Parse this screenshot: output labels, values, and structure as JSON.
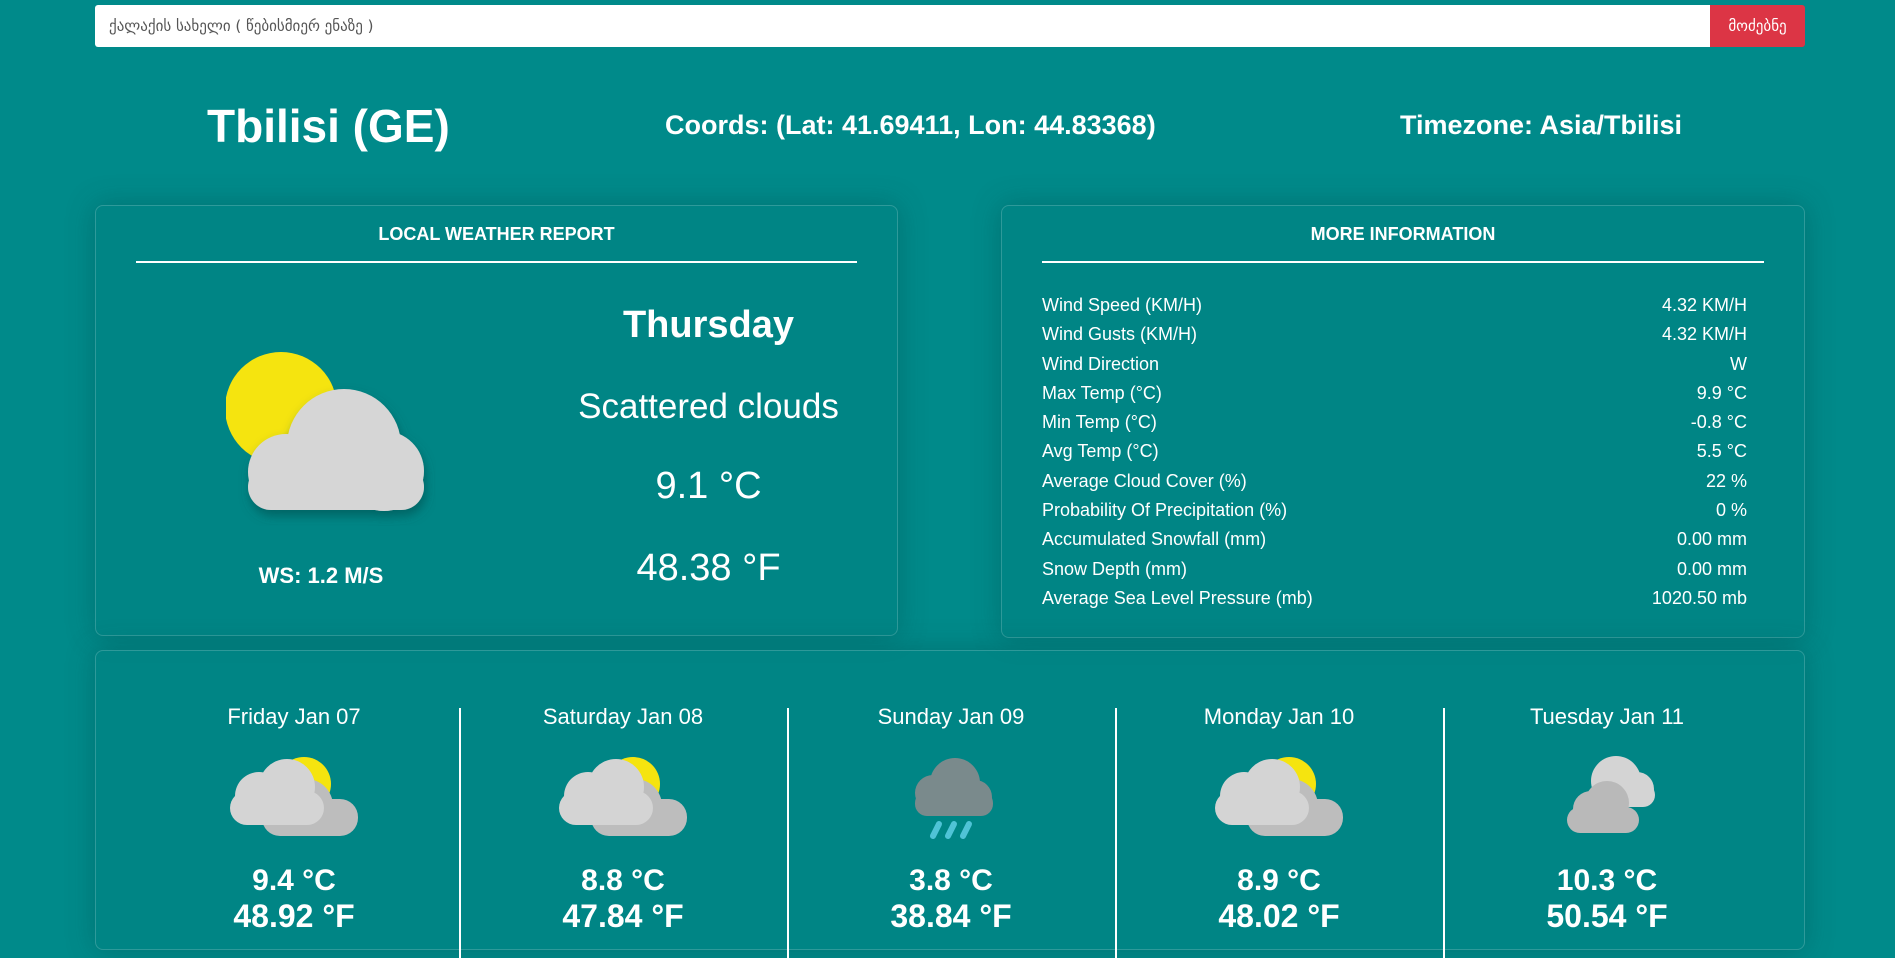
{
  "search": {
    "placeholder": "ქალაქის სახელი ( წებისმიერ ენაზე )",
    "button_label": "მოძებნე"
  },
  "header": {
    "city": "Tbilisi (GE)",
    "coords": "Coords: (Lat: 41.69411, Lon: 44.83368)",
    "timezone": "Timezone: Asia/Tbilisi"
  },
  "local_report": {
    "title": "LOCAL WEATHER REPORT",
    "icon": "partly-cloudy-day-icon",
    "wind_speed": "WS: 1.2 M/S",
    "day": "Thursday",
    "condition": "Scattered clouds",
    "temp_c": "9.1 °C",
    "temp_f": "48.38 °F"
  },
  "more_info": {
    "title": "MORE INFORMATION",
    "rows": [
      {
        "label": "Wind Speed (KM/H)",
        "value": "4.32 KM/H"
      },
      {
        "label": "Wind Gusts (KM/H)",
        "value": "4.32 KM/H"
      },
      {
        "label": "Wind Direction",
        "value": "W"
      },
      {
        "label": "Max Temp (°C)",
        "value": "9.9 °C"
      },
      {
        "label": "Min Temp (°C)",
        "value": "-0.8 °C"
      },
      {
        "label": "Avg Temp (°C)",
        "value": "5.5 °C"
      },
      {
        "label": "Average Cloud Cover (%)",
        "value": "22 %"
      },
      {
        "label": "Probability Of Precipitation (%)",
        "value": "0 %"
      },
      {
        "label": "Accumulated Snowfall (mm)",
        "value": "0.00 mm"
      },
      {
        "label": "Snow Depth (mm)",
        "value": "0.00 mm"
      },
      {
        "label": "Average Sea Level Pressure (mb)",
        "value": "1020.50 mb"
      }
    ]
  },
  "forecast": [
    {
      "date": "Friday Jan 07",
      "icon": "partly-cloudy-icon",
      "temp_c": "9.4 °C",
      "temp_f": "48.92 °F"
    },
    {
      "date": "Saturday Jan 08",
      "icon": "partly-cloudy-icon",
      "temp_c": "8.8 °C",
      "temp_f": "47.84 °F"
    },
    {
      "date": "Sunday Jan 09",
      "icon": "rain-cloud-icon",
      "temp_c": "3.8 °C",
      "temp_f": "38.84 °F"
    },
    {
      "date": "Monday Jan 10",
      "icon": "partly-cloudy-icon",
      "temp_c": "8.9 °C",
      "temp_f": "48.02 °F"
    },
    {
      "date": "Tuesday Jan 11",
      "icon": "overcast-clouds-icon",
      "temp_c": "10.3 °C",
      "temp_f": "50.54 °F"
    }
  ],
  "colors": {
    "background": "#008a8a",
    "search_button": "#dc3545",
    "sun": "#f5e40f",
    "cloud_light": "#d4d4d4",
    "cloud_dark": "#b9b9b9",
    "rain_cloud": "#7a8a8c",
    "rain_drop": "#4fc3d6"
  }
}
